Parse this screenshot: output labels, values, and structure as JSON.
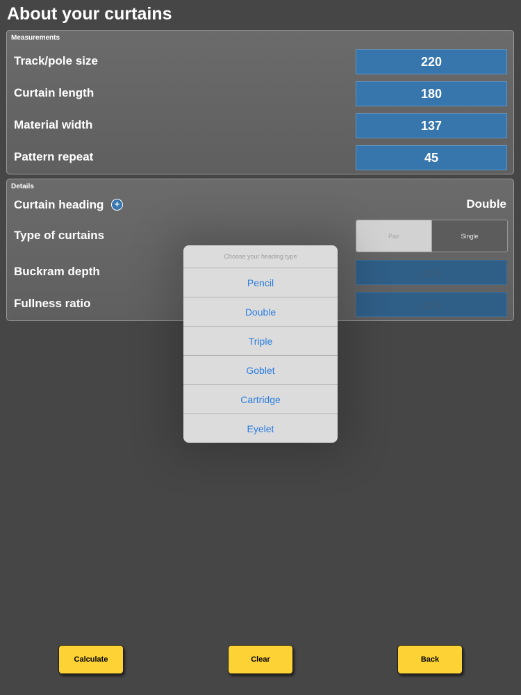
{
  "page": {
    "title": "About your curtains"
  },
  "measurements": {
    "heading": "Measurements",
    "rows": [
      {
        "label": "Track/pole size",
        "value": "220"
      },
      {
        "label": "Curtain length",
        "value": "180"
      },
      {
        "label": "Material width",
        "value": "137"
      },
      {
        "label": "Pattern repeat",
        "value": "45"
      }
    ]
  },
  "details": {
    "heading": "Details",
    "curtain_heading": {
      "label": "Curtain heading",
      "value": "Double",
      "info_icon": "plus-circle-icon"
    },
    "type_of_curtains": {
      "label": "Type of curtains",
      "options": [
        "Pair",
        "Single"
      ],
      "selected": "Pair"
    },
    "buckram_depth": {
      "label": "Buckram depth",
      "value": "",
      "placeholder": "cm"
    },
    "fullness_ratio": {
      "label": "Fullness ratio",
      "value": "",
      "placeholder": "cm"
    }
  },
  "heading_picker": {
    "title": "Choose your heading type",
    "options": [
      "Pencil",
      "Double",
      "Triple",
      "Goblet",
      "Cartridge",
      "Eyelet"
    ]
  },
  "buttons": {
    "calculate": "Calculate",
    "clear": "Clear",
    "back": "Back"
  },
  "colors": {
    "background": "#464646",
    "field_blue": "#3676ad",
    "button_yellow": "#fdd235",
    "picker_text": "#2a7de1"
  }
}
